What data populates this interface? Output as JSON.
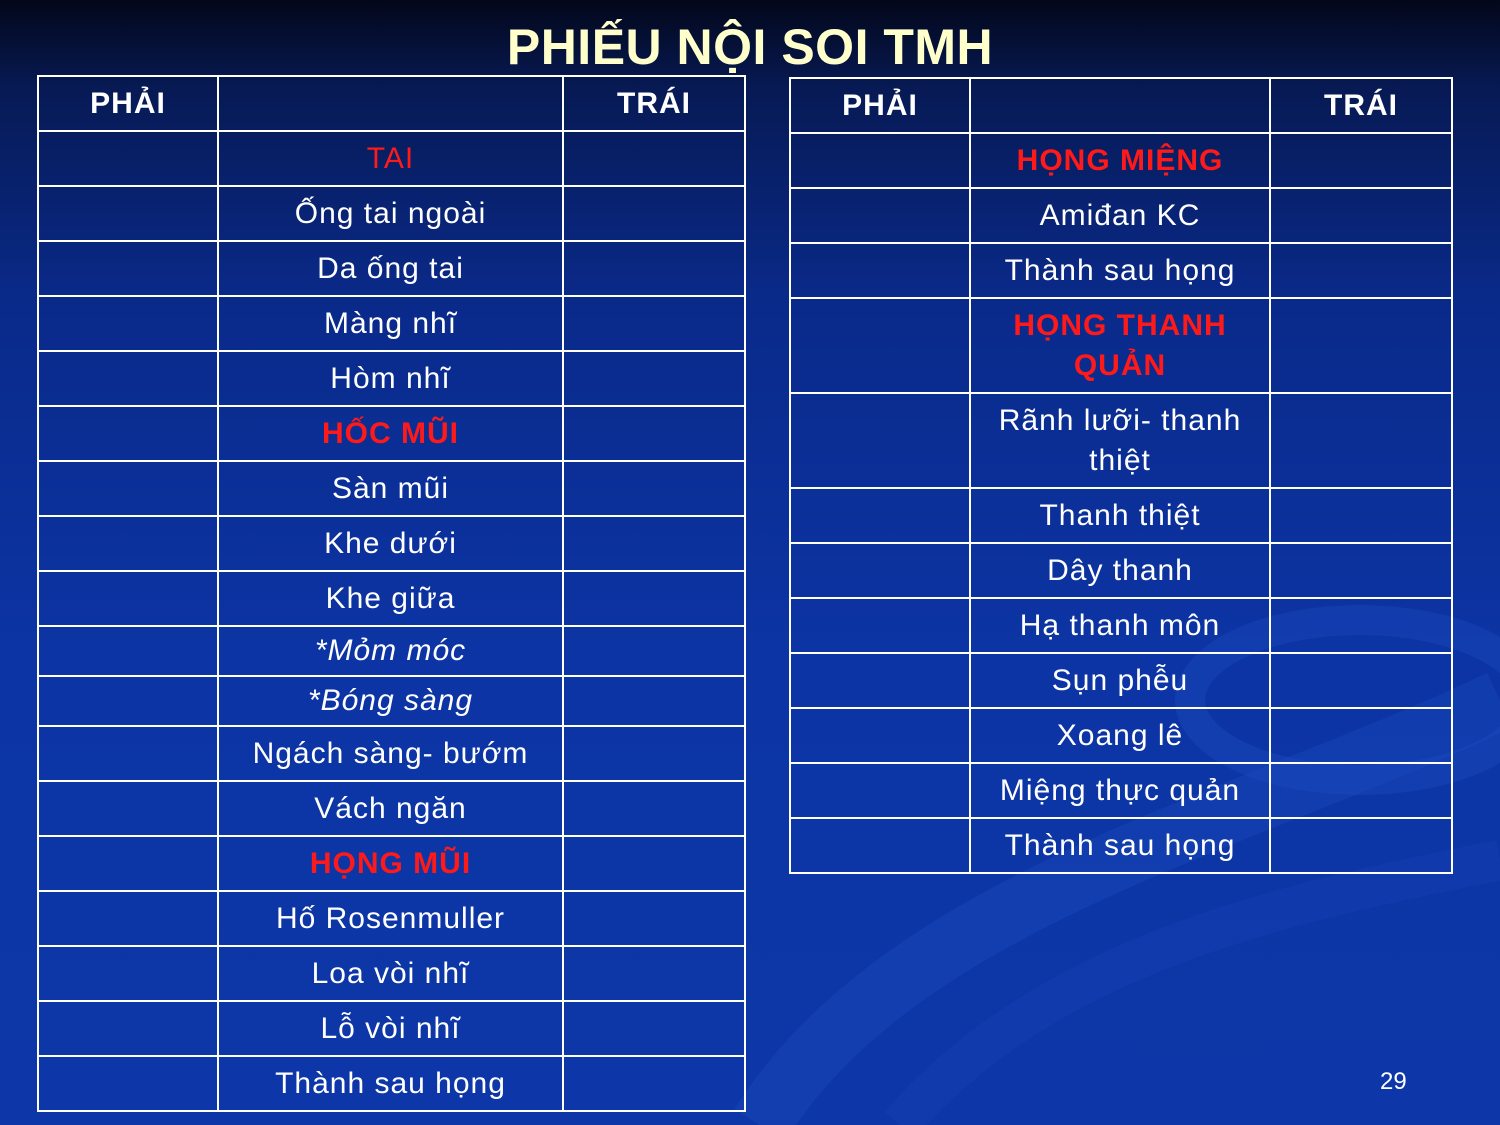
{
  "title": "PHIẾU NỘI SOI TMH",
  "page_number": "29",
  "colors": {
    "background": "#0c34a4",
    "title": "#ffffcc",
    "section": "#ff1a1a",
    "text": "#ffffff"
  },
  "left_table": {
    "header": {
      "right_side": "PHẢI",
      "middle": "",
      "left_side": "TRÁI"
    },
    "rows": [
      {
        "label": "TAI",
        "style": "red-plain"
      },
      {
        "label": "Ống tai ngoài"
      },
      {
        "label": "Da ống tai"
      },
      {
        "label": "Màng nhĩ"
      },
      {
        "label": "Hòm nhĩ"
      },
      {
        "label": "HỐC MŨI",
        "style": "red"
      },
      {
        "label": "Sàn mũi"
      },
      {
        "label": "Khe dưới"
      },
      {
        "label": "Khe giữa"
      },
      {
        "label": "*Mỏm móc",
        "style": "ital"
      },
      {
        "label": "*Bóng sàng",
        "style": "ital"
      },
      {
        "label": "Ngách sàng- bướm"
      },
      {
        "label": "Vách ngăn"
      },
      {
        "label": "HỌNG MŨI",
        "style": "red"
      },
      {
        "label": "Hố Rosenmuller"
      },
      {
        "label": "Loa vòi nhĩ"
      },
      {
        "label": "Lỗ vòi nhĩ"
      },
      {
        "label": "Thành sau họng"
      }
    ]
  },
  "right_table": {
    "header": {
      "right_side": "PHẢI",
      "middle": "",
      "left_side": "TRÁI"
    },
    "rows": [
      {
        "label": "HỌNG MIỆNG",
        "style": "red"
      },
      {
        "label": "Amiđan KC"
      },
      {
        "label": "Thành sau họng"
      },
      {
        "label": "HỌNG THANH QUẢN",
        "style": "red",
        "tall": true
      },
      {
        "label": "Rãnh lưỡi- thanh thiệt",
        "tall": true
      },
      {
        "label": "Thanh thiệt"
      },
      {
        "label": "Dây thanh"
      },
      {
        "label": "Hạ thanh môn"
      },
      {
        "label": "Sụn phễu"
      },
      {
        "label": "Xoang lê"
      },
      {
        "label": "Miệng thực quản"
      },
      {
        "label": "Thành sau họng"
      }
    ]
  }
}
